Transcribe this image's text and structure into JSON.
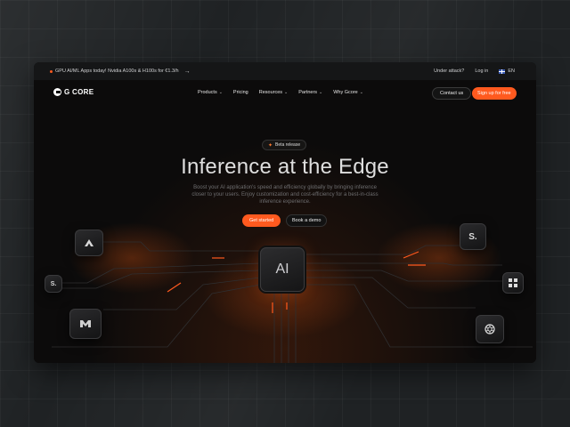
{
  "topbar": {
    "promo_text": "GPU AI/ML Apps today! Nvidia A100s & H100s for €1.3/h",
    "promo_arrow": "→",
    "under_attack": "Under attack?",
    "login": "Log in",
    "lang": "EN"
  },
  "nav": {
    "logo_text": "G CORE",
    "menu": [
      {
        "label": "Products",
        "chevron": "⌄"
      },
      {
        "label": "Pricing"
      },
      {
        "label": "Resources",
        "chevron": "⌄"
      },
      {
        "label": "Partners",
        "chevron": "⌄"
      },
      {
        "label": "Why Gcore",
        "chevron": "⌄"
      }
    ],
    "contact_us": "Contact us",
    "sign_up": "Sign up for free"
  },
  "hero": {
    "badge": "Beta release",
    "title": "Inference at the Edge",
    "subtitle": "Boost your AI application's speed and efficiency globally by bringing inference closer to your users. Enjoy customization and cost-efficiency for a best-in-class inference experience.",
    "get_started": "Get started",
    "book_demo": "Book a demo"
  },
  "diagram": {
    "chip_label": "AI",
    "nodes": [
      "mistral-icon",
      "s-icon",
      "s-icon-small",
      "meta-m-icon",
      "grid-icon",
      "openai-icon"
    ]
  },
  "colors": {
    "accent": "#ff5a1f",
    "background": "#0c0b0b"
  }
}
